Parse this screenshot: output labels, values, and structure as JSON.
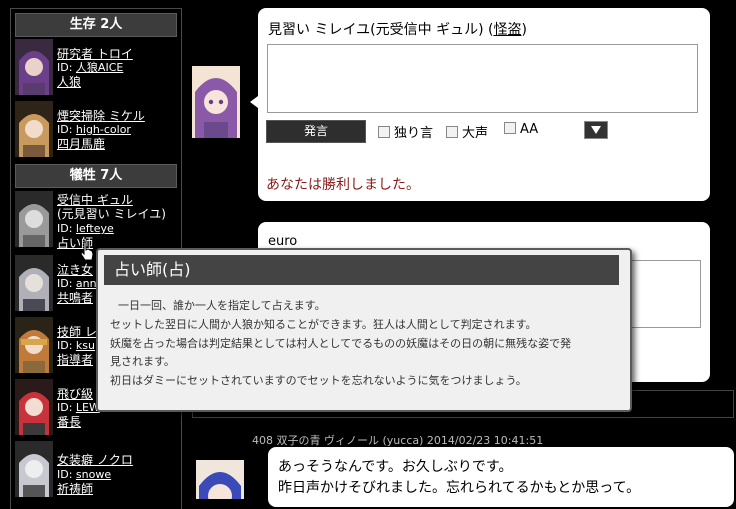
{
  "sidebar": {
    "alive_header": "生存 2人",
    "alive": [
      {
        "name": "研究者 トロイ",
        "id_prefix": "ID: ",
        "id": "人狼AICE",
        "role": "人狼"
      },
      {
        "name": "煙突掃除 ミケル",
        "id_prefix": "ID: ",
        "id": "high-color",
        "role": "四月馬鹿"
      }
    ],
    "dead_header": "犠牲 7人",
    "dead": [
      {
        "name": "受信中 ギュル",
        "alias": "(元見習い ミレイユ)",
        "id_prefix": "ID: ",
        "id": "lefteye",
        "role": "占い師"
      },
      {
        "name": "泣き女",
        "id_prefix": "ID: ",
        "id": "ann",
        "role": "共鳴者"
      },
      {
        "name": "技師 レ",
        "id_prefix": "ID: ",
        "id": "ksu",
        "role": "指導者"
      },
      {
        "name": "飛び級",
        "id_prefix": "ID: ",
        "id": "LEW",
        "role": "番長"
      },
      {
        "name": "女装癖 ノクロ",
        "id_prefix": "ID: ",
        "id": "snowe",
        "role": "祈祷師"
      }
    ]
  },
  "composer": {
    "speaker_name": "見習い ミレイユ(元受信中 ギュル)",
    "speaker_link": "怪盗",
    "open_paren": " (",
    "close_paren": ")",
    "post_label": "発言",
    "options": [
      "独り言",
      "大声",
      "AA"
    ],
    "result_text": "あなたは勝利しました。"
  },
  "second_post": {
    "name_fragment": "euro"
  },
  "tooltip": {
    "title": "占い師(占)",
    "lines": [
      "一日一回、誰か一人を指定して占えます。",
      "セットした翌日に人間か人狼か知ることができます。狂人は人間として判定されます。",
      "妖魔を占った場合は判定結果としては村人としてでるものの妖魔はその日の朝に無残な姿で発",
      "見されます。",
      "初日はダミーにセットされていますのでセットを忘れないように気をつけましょう。"
    ]
  },
  "log_post": {
    "number": "408",
    "speaker": "双子の青 ヴィノール (yucca)",
    "timestamp": "2014/02/23 10:41:51",
    "message_lines": [
      "あっそうなんです。お久しぶりです。",
      "昨日声かけそびれました。忘れられてるかもとか思って。"
    ]
  },
  "colors": {
    "background": "#000000",
    "header_bg": "#3c3c3c",
    "result_text": "#8b1a1a",
    "tooltip_bg": "#f0f0f0"
  }
}
